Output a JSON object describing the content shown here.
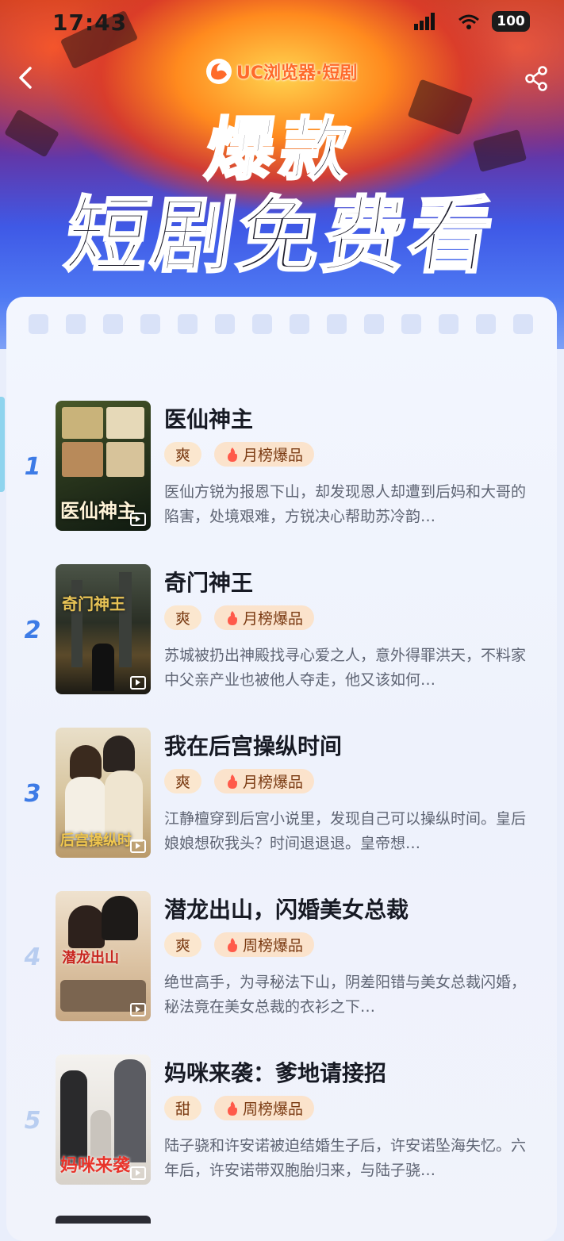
{
  "status": {
    "time": "17:43",
    "battery": "100"
  },
  "brand": {
    "name": "UC浏览器·短剧"
  },
  "headline": {
    "line1": "爆款",
    "line2": "短剧免费看"
  },
  "colors": {
    "rank_active": "#3d7be6",
    "tag_bg": "#fbe7cf",
    "brand": "#ff6a2a"
  },
  "icons": {
    "back": "chevron-left-icon",
    "share": "share-icon",
    "hot": "fire-icon",
    "play": "play-icon"
  },
  "list": [
    {
      "rank": "1",
      "title": "医仙神主",
      "cover_text": "医仙神主",
      "tag": "爽",
      "badge": "月榜爆品",
      "desc": "医仙方锐为报恩下山，却发现恩人却遭到后妈和大哥的陷害，处境艰难，方锐决心帮助苏冷韵…"
    },
    {
      "rank": "2",
      "title": "奇门神王",
      "cover_text": "奇门神王",
      "tag": "爽",
      "badge": "月榜爆品",
      "desc": "苏城被扔出神殿找寻心爱之人，意外得罪洪天，不料家中父亲产业也被他人夺走，他又该如何…"
    },
    {
      "rank": "3",
      "title": "我在后宫操纵时间",
      "cover_text": "后宫操纵时",
      "tag": "爽",
      "badge": "月榜爆品",
      "desc": "江静檀穿到后宫小说里，发现自己可以操纵时间。皇后娘娘想砍我头？时间退退退。皇帝想…"
    },
    {
      "rank": "4",
      "title": "潜龙出山，闪婚美女总裁",
      "cover_text": "潜龙出山",
      "tag": "爽",
      "badge": "周榜爆品",
      "desc": "绝世高手，为寻秘法下山，阴差阳错与美女总裁闪婚，秘法竟在美女总裁的衣衫之下…"
    },
    {
      "rank": "5",
      "title": "妈咪来袭：爹地请接招",
      "cover_text": "妈咪来袭",
      "tag": "甜",
      "badge": "周榜爆品",
      "desc": "陆子骁和许安诺被迫结婚生子后，许安诺坠海失忆。六年后，许安诺带双胞胎归来，与陆子骁…"
    }
  ]
}
